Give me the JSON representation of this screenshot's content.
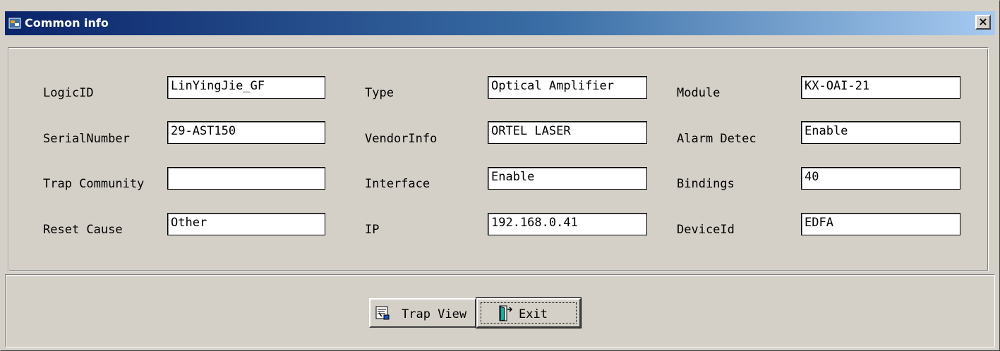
{
  "window": {
    "title": "Common info",
    "close_label": "×"
  },
  "fields": [
    {
      "label": "LogicID",
      "value": "LinYingJie_GF"
    },
    {
      "label": "Type",
      "value": "Optical Amplifier"
    },
    {
      "label": "Module",
      "value": "KX-OAI-21"
    },
    {
      "label": "SerialNumber",
      "value": "29-AST150"
    },
    {
      "label": "VendorInfo",
      "value": "ORTEL LASER"
    },
    {
      "label": "Alarm Detec",
      "value": "Enable"
    },
    {
      "label": "Trap Community",
      "value": ""
    },
    {
      "label": "Interface",
      "value": "Enable"
    },
    {
      "label": "Bindings",
      "value": "40"
    },
    {
      "label": "Reset Cause",
      "value": "Other"
    },
    {
      "label": "IP",
      "value": "192.168.0.41"
    },
    {
      "label": "DeviceId",
      "value": "EDFA"
    }
  ],
  "buttons": {
    "trap_view": "Trap View",
    "exit": "Exit"
  },
  "icons": {
    "app": "app-window-icon",
    "trap_view": "trap-report-icon",
    "exit": "exit-door-icon"
  }
}
